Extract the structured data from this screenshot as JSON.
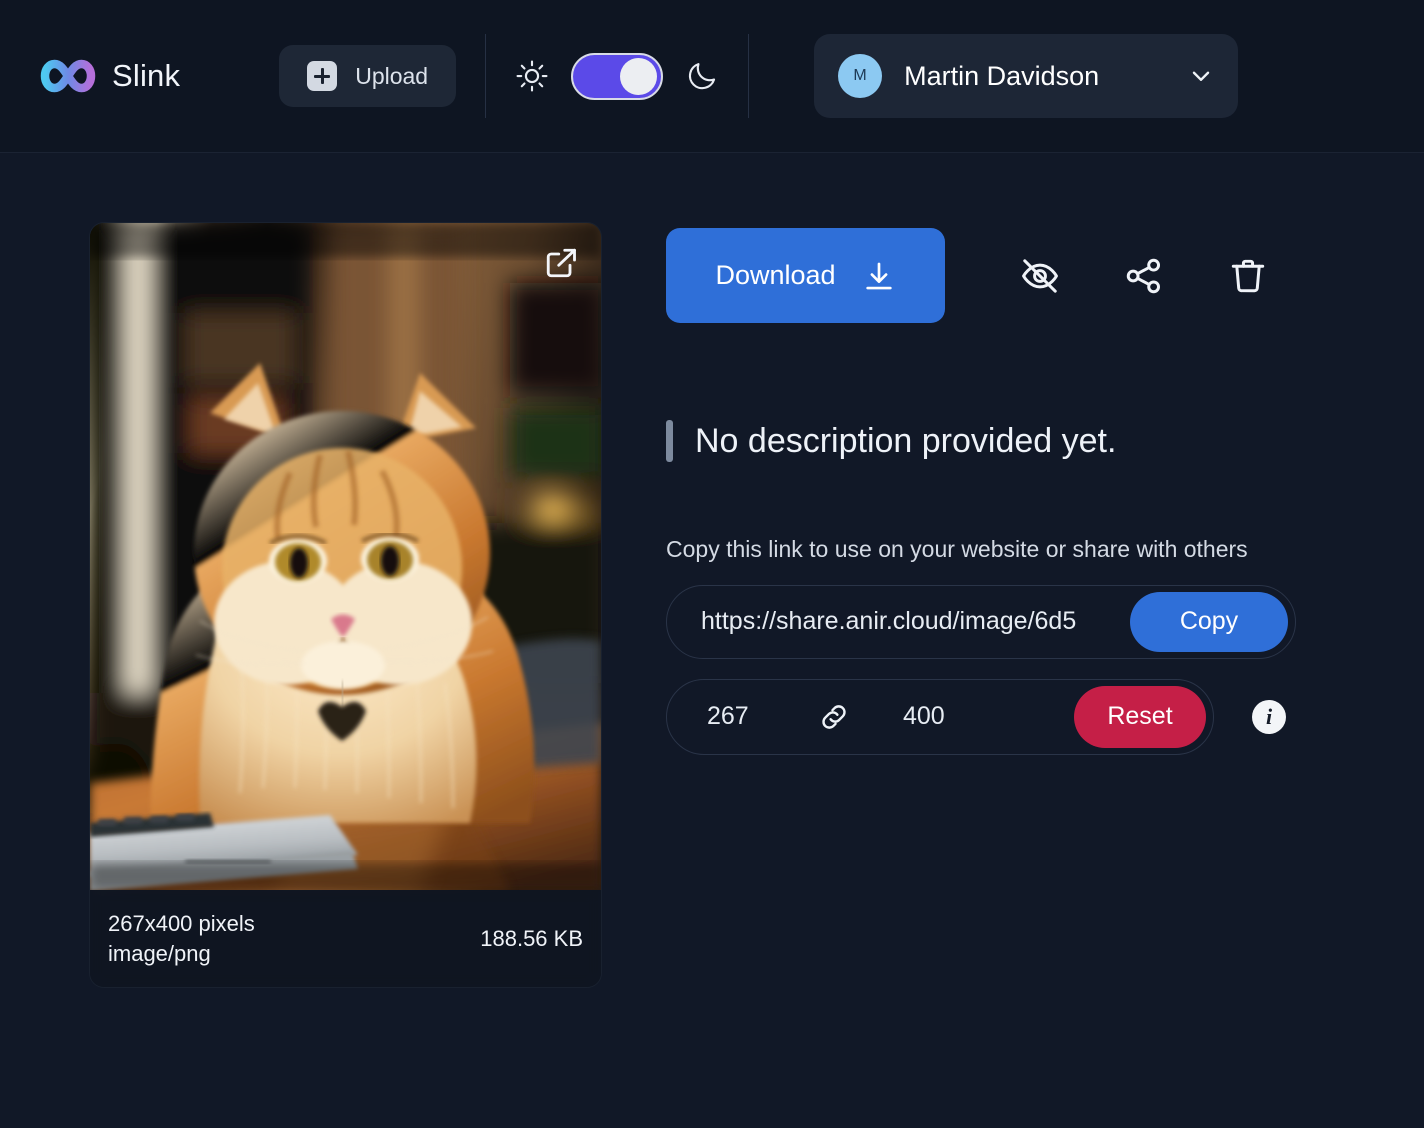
{
  "header": {
    "brand": {
      "name": "Slink",
      "logo_icon": "infinity-logo-icon",
      "gradient_from": "#4ec9f0",
      "gradient_to": "#b56fda"
    },
    "upload": {
      "label": "Upload",
      "icon": "plus-square-icon"
    },
    "theme": {
      "light_icon": "sun-icon",
      "dark_icon": "moon-icon",
      "toggle_state": "dark",
      "toggle_color": "#5b4ae8"
    },
    "user": {
      "avatar_initial": "M",
      "avatar_color": "#8cc9f2",
      "name": "Martin Davidson",
      "chevron_icon": "chevron-down-icon"
    }
  },
  "image_card": {
    "open_icon": "external-link-icon",
    "dimensions_label": "267x400 pixels",
    "mime_type": "image/png",
    "file_size": "188.56 KB",
    "alt": "Fluffy orange long-haired cat sitting behind a laptop on a wooden desk"
  },
  "details": {
    "download": {
      "label": "Download",
      "icon": "download-icon",
      "color": "#2f6fd8"
    },
    "actions": [
      {
        "name": "hide-button",
        "icon": "eye-off-icon"
      },
      {
        "name": "share-button",
        "icon": "share-icon"
      },
      {
        "name": "delete-button",
        "icon": "trash-icon"
      }
    ],
    "description": "No description provided yet.",
    "copy_hint": "Copy this link to use on your website or share with others",
    "share_link": {
      "url": "https://share.anir.cloud/image/6d5",
      "copy_label": "Copy"
    },
    "resize": {
      "width": "267",
      "height": "400",
      "link_icon": "chain-link-icon",
      "reset_label": "Reset",
      "reset_color": "#c51f47",
      "info_icon": "info-icon"
    }
  }
}
